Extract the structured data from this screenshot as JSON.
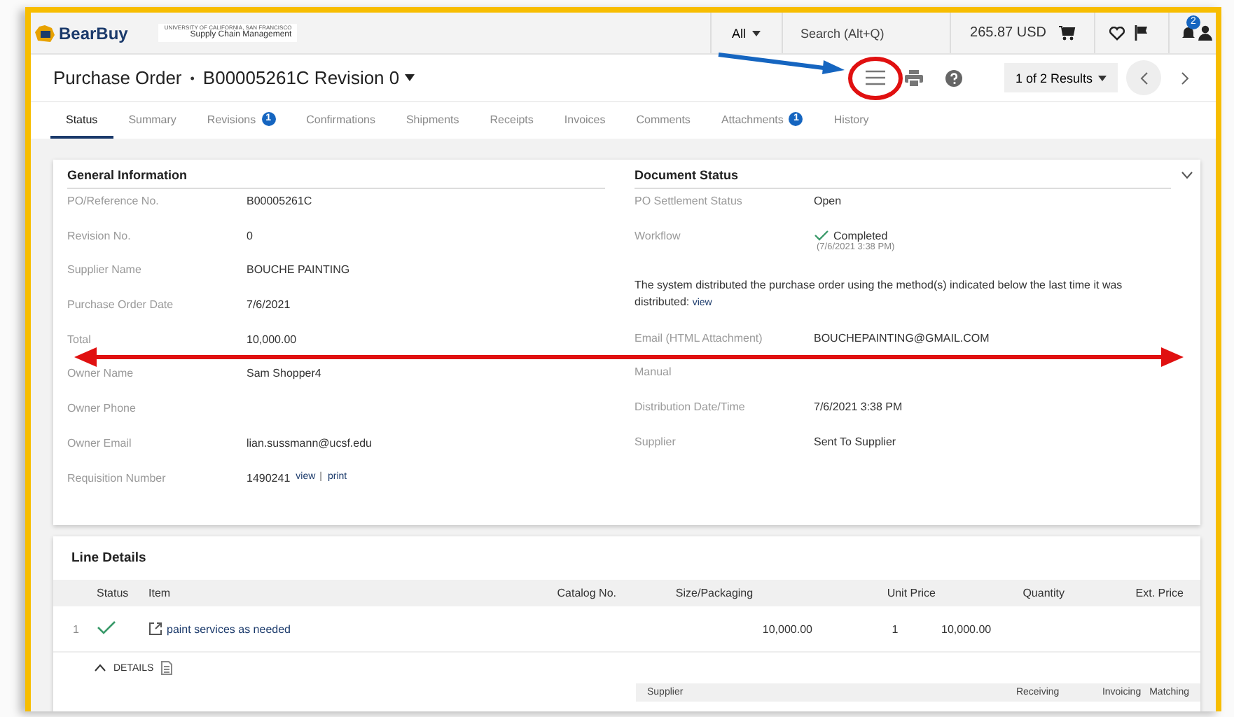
{
  "header": {
    "logo": "BearBuy",
    "org_line_1": "UNIVERSITY OF CALIFORNIA, SAN FRANCISCO",
    "org_line_2": "Supply Chain Management",
    "scope": "All",
    "search": {
      "placeholder": "Search (Alt+Q)"
    },
    "cart_total": "265.87 USD",
    "notification_count": "2"
  },
  "title_bar": {
    "doc_type": "Purchase Order",
    "separator": "•",
    "document": "B00005261C Revision 0",
    "results": "1 of 2 Results"
  },
  "tabs": [
    {
      "label": "Status",
      "selected": true
    },
    {
      "label": "Summary",
      "selected": false
    },
    {
      "label": "Revisions",
      "selected": false,
      "badge": "1"
    },
    {
      "label": "Confirmations",
      "selected": false
    },
    {
      "label": "Shipments",
      "selected": false
    },
    {
      "label": "Receipts",
      "selected": false
    },
    {
      "label": "Invoices",
      "selected": false
    },
    {
      "label": "Comments",
      "selected": false
    },
    {
      "label": "Attachments",
      "selected": false,
      "badge": "1"
    },
    {
      "label": "History",
      "selected": false
    }
  ],
  "general_information": {
    "title": "General Information",
    "fields": [
      {
        "label": "PO/Reference No.",
        "value": "B00005261C"
      },
      {
        "label": "Revision No.",
        "value": "0"
      },
      {
        "label": "Supplier Name",
        "value": "BOUCHE PAINTING"
      },
      {
        "label": "Purchase Order Date",
        "value": "7/6/2021"
      },
      {
        "label": "Total",
        "value": "10,000.00"
      },
      {
        "label": "Owner Name",
        "value": "Sam Shopper4"
      },
      {
        "label": "Owner Phone"
      },
      {
        "label": "Owner Email",
        "value": "lian.sussmann@ucsf.edu"
      },
      {
        "label": "Requisition Number",
        "value": "1490241",
        "links": [
          "view",
          "print"
        ],
        "link_separator": "|"
      }
    ]
  },
  "document_status": {
    "title": "Document Status",
    "expanded": true,
    "fields": [
      {
        "label": "PO Settlement Status",
        "value": "Open"
      },
      {
        "label": "Workflow",
        "value": "Completed",
        "completed": true,
        "detail": "(7/6/2021 3:38 PM)"
      }
    ],
    "note": "The system distributed the purchase order using the method(s) indicated below the last time it was distributed:",
    "note_link": "view",
    "distribution": [
      {
        "label": "Email (HTML Attachment)",
        "value": "BOUCHEPAINTING@GMAIL.COM"
      },
      {
        "label": "Manual"
      },
      {
        "label": "Distribution Date/Time",
        "value": "7/6/2021 3:38 PM"
      },
      {
        "label": "Supplier",
        "value": "Sent To Supplier"
      }
    ]
  },
  "line_details": {
    "title": "Line Details",
    "columns": [
      "Status",
      "Item",
      "Catalog No.",
      "Size/Packaging",
      "Unit Price",
      "Quantity",
      "Ext. Price"
    ],
    "rows": [
      {
        "number": "1",
        "completed": true,
        "item": "paint services as needed",
        "size_packaging": "10,000.00",
        "unit_price": "1",
        "quantity": "10,000.00"
      }
    ],
    "details_toggle": {
      "label": "DETAILS",
      "expanded": true
    },
    "sub_columns": [
      "Supplier",
      "Receiving",
      "Invoicing",
      "Matching"
    ]
  }
}
